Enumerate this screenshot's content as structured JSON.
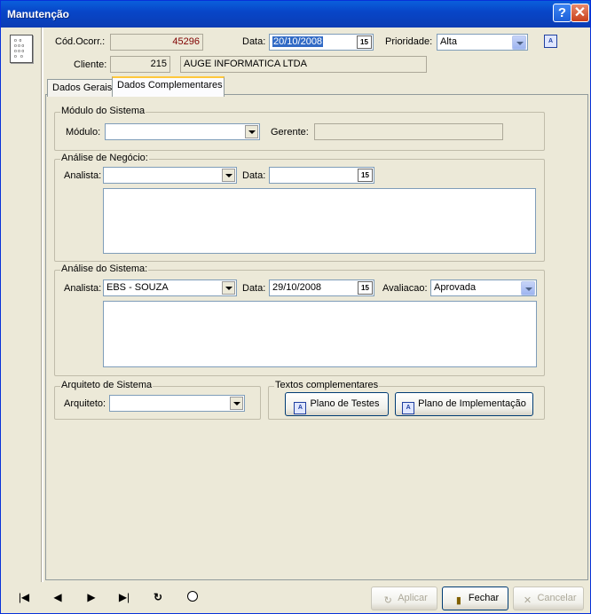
{
  "window": {
    "title": "Manutenção",
    "help_label": "?",
    "close_label": "✕"
  },
  "header": {
    "cod_ocorr_label": "Cód.Ocorr.:",
    "cod_ocorr_value": "45296",
    "data_label": "Data:",
    "data_value": "20/10/2008",
    "prioridade_label": "Prioridade:",
    "prioridade_value": "Alta",
    "cliente_label": "Cliente:",
    "cliente_code": "215",
    "cliente_name": "AUGE INFORMATICA LTDA"
  },
  "tabs": [
    {
      "label": "Dados Gerais"
    },
    {
      "label": "Dados Complementares"
    }
  ],
  "modulo_group": {
    "title": "Módulo do Sistema",
    "modulo_label": "Módulo:",
    "modulo_value": "",
    "gerente_label": "Gerente:",
    "gerente_value": ""
  },
  "negocio_group": {
    "title": "Análise de Negócio:",
    "analista_label": "Analista:",
    "analista_value": "",
    "data_label": "Data:",
    "data_value": ""
  },
  "sistema_group": {
    "title": "Análise do Sistema:",
    "analista_label": "Analista:",
    "analista_value": "EBS - SOUZA",
    "data_label": "Data:",
    "data_value": "29/10/2008",
    "avaliacao_label": "Avaliacao:",
    "avaliacao_value": "Aprovada"
  },
  "arquiteto_group": {
    "title": "Arquiteto de Sistema",
    "arquiteto_label": "Arquiteto:",
    "arquiteto_value": ""
  },
  "textos_group": {
    "title": "Textos complementares",
    "plano_testes_label": "Plano de Testes",
    "plano_impl_label": "Plano de Implementação"
  },
  "footer": {
    "aplicar_label": "Aplicar",
    "fechar_label": "Fechar",
    "cancelar_label": "Cancelar"
  },
  "calendar_glyph": "15",
  "icons": [
    "document-list-icon",
    "calendar-icon",
    "text-document-icon",
    "nav-first-icon",
    "nav-prev-icon",
    "nav-next-icon",
    "nav-last-icon",
    "refresh-icon",
    "record-icon",
    "apply-icon",
    "door-exit-icon",
    "cancel-x-icon"
  ]
}
